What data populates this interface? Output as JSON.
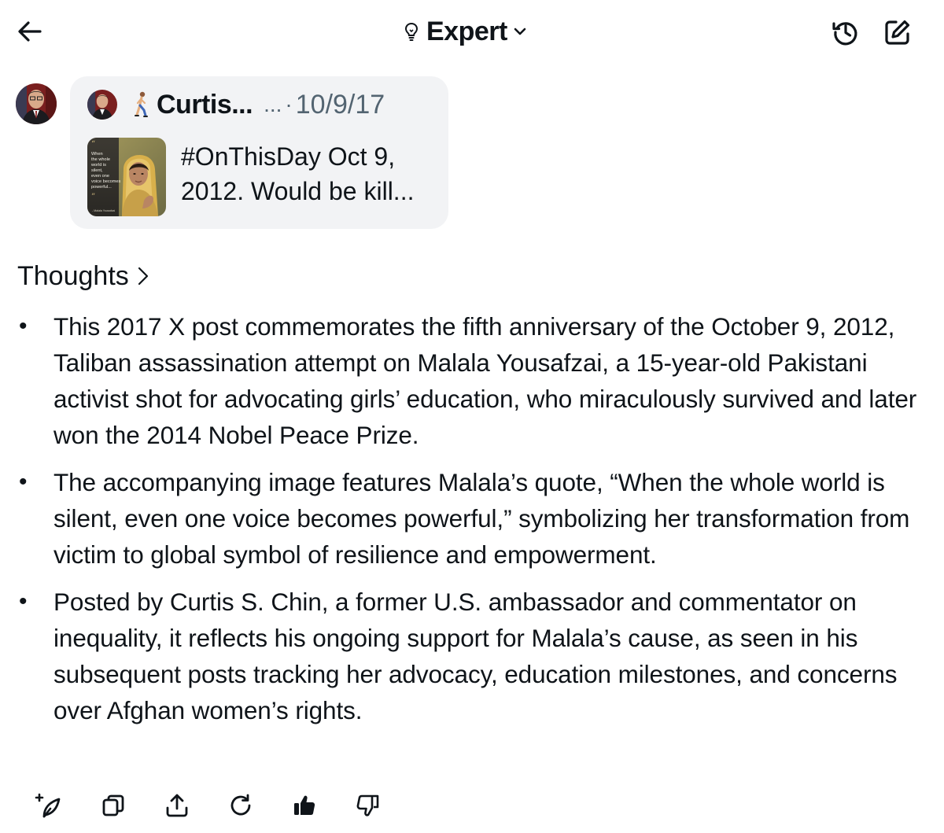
{
  "header": {
    "back_icon": "arrow-left-icon",
    "mode_icon": "lightbulb-icon",
    "mode_label": "Expert",
    "mode_chevron_icon": "chevron-down-icon",
    "history_icon": "history-icon",
    "compose_icon": "compose-icon"
  },
  "post_card": {
    "author_short": "Curtis...",
    "walker_emoji": "🚶",
    "handle_truncated": "...",
    "separator": "·",
    "date": "10/9/17",
    "text": "#OnThisDay Oct 9, 2012. Would be kill...",
    "thumbnail": {
      "quote_lines": [
        "When",
        "the whole",
        "world is",
        "silent,",
        "even one",
        "voice becomes",
        "powerful..."
      ],
      "attribution": "- Malala Yousafzai"
    }
  },
  "thoughts": {
    "label": "Thoughts",
    "chevron_icon": "chevron-right-icon"
  },
  "response": {
    "bullets": [
      {
        "mark": "•",
        "text": "This 2017 X post commemorates the fifth anniversary of the October 9, 2012, Taliban assassination attempt on Malala Yousafzai, a 15-year-old Pakistani activist shot for advocating girls’ education, who miraculously survived and later won the 2014 Nobel Peace Prize."
      },
      {
        "mark": "•",
        "text": "The accompanying image features Malala’s quote, “When the whole world is silent, even one voice becomes powerful,” symbolizing her transformation from victim to global symbol of resilience and empowerment."
      },
      {
        "mark": "•",
        "text": "Posted by Curtis S. Chin, a former U.S. ambassador and commentator on inequality, it reflects his ongoing support for Malala’s cause, as seen in his subsequent posts tracking her advocacy, education milestones, and concerns over Afghan women’s rights."
      }
    ]
  },
  "actions": [
    {
      "name": "regenerate-sparkle-icon"
    },
    {
      "name": "copy-icon"
    },
    {
      "name": "share-icon"
    },
    {
      "name": "refresh-icon"
    },
    {
      "name": "thumbs-up-icon"
    },
    {
      "name": "thumbs-down-icon"
    }
  ]
}
